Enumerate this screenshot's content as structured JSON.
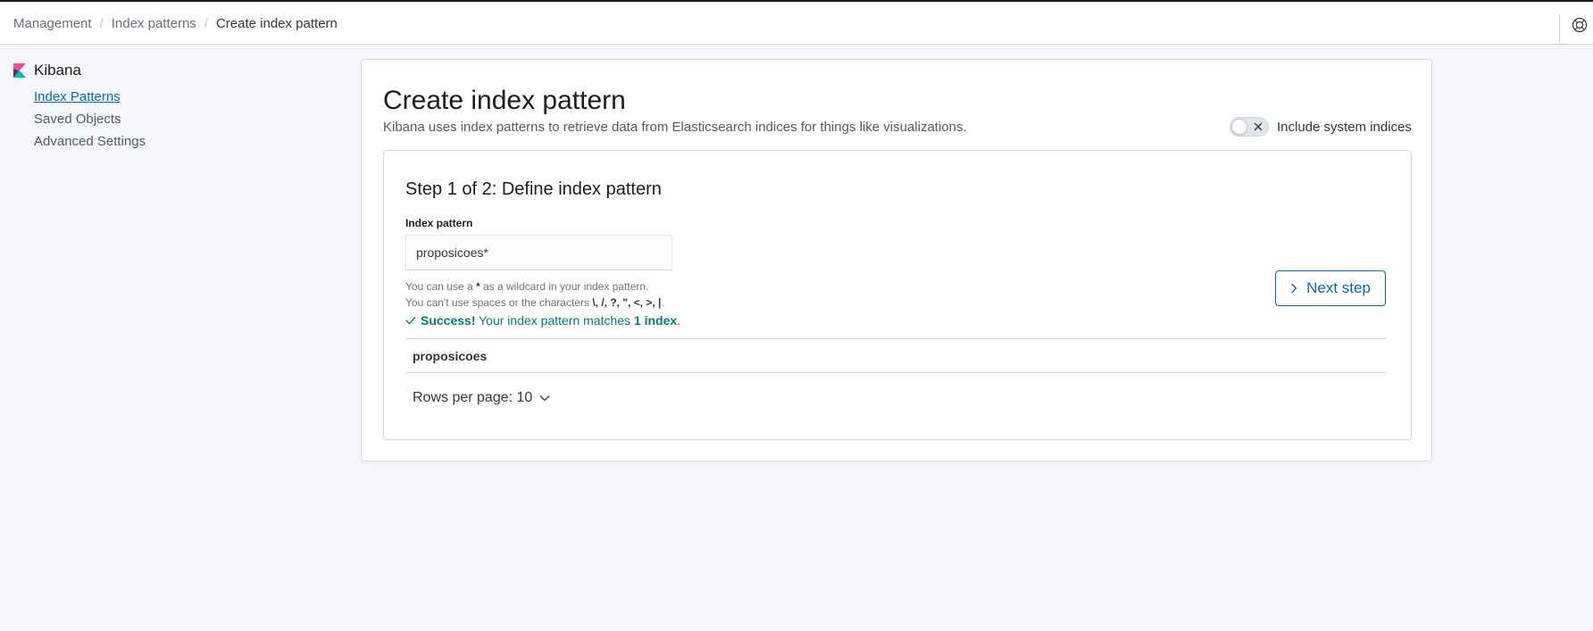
{
  "breadcrumbs": {
    "items": [
      "Management",
      "Index patterns"
    ],
    "current": "Create index pattern"
  },
  "topbar": {
    "help_icon": "help-icon"
  },
  "sidebar": {
    "app_title": "Kibana",
    "items": [
      {
        "label": "Index Patterns",
        "active": true
      },
      {
        "label": "Saved Objects",
        "active": false
      },
      {
        "label": "Advanced Settings",
        "active": false
      }
    ]
  },
  "main": {
    "title": "Create index pattern",
    "description": "Kibana uses index patterns to retrieve data from Elasticsearch indices for things like visualizations.",
    "system_toggle": {
      "label": "Include system indices",
      "checked": false
    },
    "step": {
      "title": "Step 1 of 2: Define index pattern",
      "field_label": "Index pattern",
      "input_value": "proposicoes*",
      "help_line1_prefix": "You can use a ",
      "help_line1_code": "*",
      "help_line1_suffix": " as a wildcard in your index pattern.",
      "help_line2_prefix": "You can't use spaces or the characters ",
      "help_line2_chars": "\\, /, ?, \", <, >, |",
      "help_line2_suffix": ".",
      "success_strong": "Success!",
      "success_text": " Your index pattern matches ",
      "success_count": "1 index",
      "success_end": ".",
      "next_button": "Next step",
      "table_rows": [
        "proposicoes"
      ],
      "rows_per_page": "Rows per page: 10"
    }
  },
  "colors": {
    "accent": "#006bb8",
    "success": "#017d73",
    "kibana_logo_pink": "#f04e98",
    "kibana_logo_teal": "#00bfb3"
  }
}
